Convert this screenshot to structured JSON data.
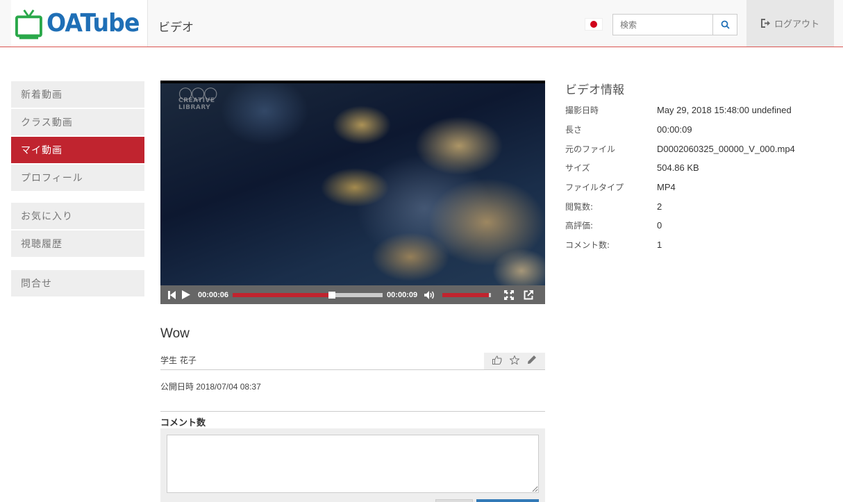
{
  "header": {
    "logo_text": "OATube",
    "page_title": "ビデオ",
    "search_placeholder": "検索",
    "logout_label": "ログアウト"
  },
  "sidebar": {
    "group1": [
      {
        "label": "新着動画",
        "active": false
      },
      {
        "label": "クラス動画",
        "active": false
      },
      {
        "label": "マイ動画",
        "active": true
      },
      {
        "label": "プロフィール",
        "active": false
      }
    ],
    "group2": [
      {
        "label": "お気に入り"
      },
      {
        "label": "視聴履歴"
      }
    ],
    "group3": [
      {
        "label": "問合せ"
      }
    ]
  },
  "player": {
    "current_time": "00:00:06",
    "duration": "00:00:09",
    "progress": 0.66,
    "volume": 0.95,
    "watermark_line1": "CREATIVE",
    "watermark_line2": "LIBRARY"
  },
  "video": {
    "title": "Wow",
    "author": "学生 花子",
    "published_label": "公開日時",
    "published_value": "2018/07/04 08:37",
    "comment_label": "コメント数"
  },
  "info": {
    "title": "ビデオ情報",
    "rows": [
      {
        "label": "撮影日時",
        "value": "May 29, 2018 15:48:00 undefined"
      },
      {
        "label": "長さ",
        "value": "00:00:09"
      },
      {
        "label": "元のファイル",
        "value": "D0002060325_00000_V_000.mp4"
      },
      {
        "label": "サイズ",
        "value": "504.86 KB"
      },
      {
        "label": "ファイルタイプ",
        "value": "MP4"
      },
      {
        "label": "閲覧数:",
        "value": "2"
      },
      {
        "label": "高評価:",
        "value": "0"
      },
      {
        "label": "コメント数:",
        "value": "1"
      }
    ]
  },
  "colors": {
    "accent": "#c0242f",
    "logo_blue": "#1f6fb6",
    "logo_green": "#2aa84a",
    "flag_red": "#d0021b"
  },
  "icons": [
    "tv-logo-icon",
    "japan-flag-icon",
    "search-icon",
    "logout-icon",
    "skip-back-icon",
    "play-icon",
    "volume-icon",
    "fullscreen-icon",
    "popout-icon",
    "thumbs-up-icon",
    "star-icon",
    "pencil-icon"
  ]
}
